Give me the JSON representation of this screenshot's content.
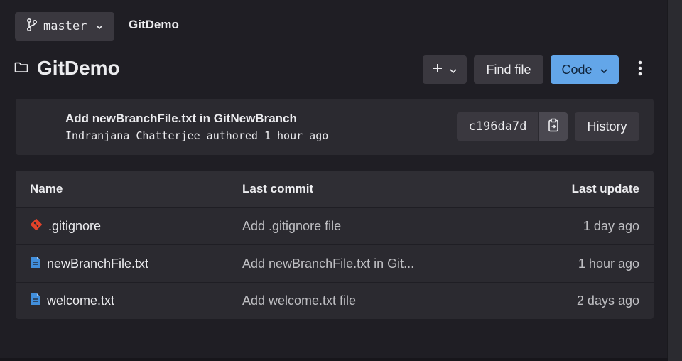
{
  "branch": {
    "name": "master",
    "icon": "git-branch-icon"
  },
  "breadcrumb": "GitDemo",
  "repo": {
    "title": "GitDemo",
    "icon": "folder-icon"
  },
  "toolbar": {
    "add_label": "+",
    "find_file_label": "Find file",
    "code_label": "Code",
    "code_color": "#63a6e9"
  },
  "last_commit": {
    "title": "Add newBranchFile.txt in GitNewBranch",
    "author_line": "Indranjana Chatterjee authored 1 hour ago",
    "sha": "c196da7d",
    "history_label": "History"
  },
  "table": {
    "headers": {
      "name": "Name",
      "commit": "Last commit",
      "update": "Last update"
    },
    "rows": [
      {
        "icon": "git-file-icon",
        "name": ".gitignore",
        "commit": "Add .gitignore file",
        "update": "1 day ago"
      },
      {
        "icon": "document-icon",
        "name": "newBranchFile.txt",
        "commit": "Add newBranchFile.txt in Git...",
        "update": "1 hour ago"
      },
      {
        "icon": "document-icon",
        "name": "welcome.txt",
        "commit": "Add welcome.txt file",
        "update": "2 days ago"
      }
    ]
  },
  "colors": {
    "background": "#1f1e24",
    "panel": "#2b2a30",
    "accent": "#63a6e9",
    "gitignore_icon": "#e2432a",
    "doc_icon": "#428fdc"
  }
}
